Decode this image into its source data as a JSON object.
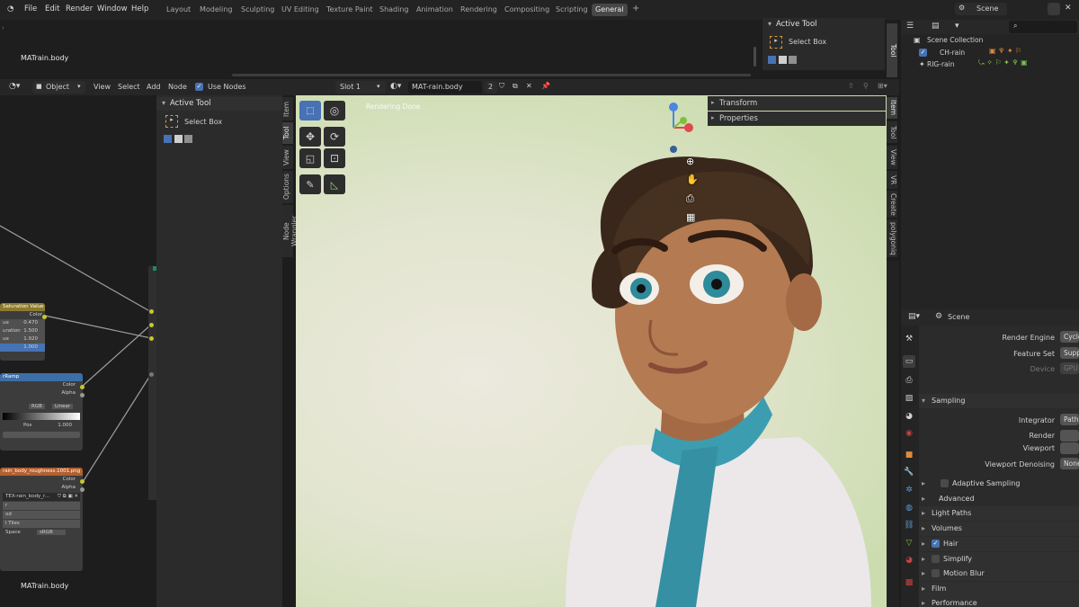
{
  "top_menu": {
    "file": "File",
    "edit": "Edit",
    "render": "Render",
    "window": "Window",
    "help": "Help"
  },
  "workspace_tabs": [
    "Layout",
    "Modeling",
    "Sculpting",
    "UV Editing",
    "Texture Paint",
    "Shading",
    "Animation",
    "Rendering",
    "Compositing",
    "Scripting",
    "General"
  ],
  "scene_name": "Scene",
  "top_editor": {
    "material_label": "MATrain.body"
  },
  "top_active_tool": {
    "title": "Active Tool",
    "tool": "Select Box",
    "tab": "Tool"
  },
  "node_header": {
    "mode": "Object",
    "view": "View",
    "select": "Select",
    "add": "Add",
    "node": "Node",
    "use_nodes": "Use Nodes",
    "slot": "Slot 1",
    "material": "MAT-rain.body",
    "users": "2"
  },
  "node_sidebar": {
    "title": "Active Tool",
    "tool": "Select Box",
    "tabs": [
      "Item",
      "Tool",
      "View",
      "Options",
      "Node Wrangler"
    ]
  },
  "nodes": {
    "hsv": {
      "title": "Saturation Value",
      "out": "Color",
      "rows": [
        {
          "label": "ue",
          "value": "0.470"
        },
        {
          "label": "uration",
          "value": "1.500"
        },
        {
          "label": "ue",
          "value": "1.920"
        },
        {
          "label": "",
          "value": "1.000"
        }
      ]
    },
    "ramp": {
      "title": "rRamp",
      "out1": "Color",
      "out2": "Alpha",
      "mode": "RGB",
      "interp": "Linear",
      "pos_label": "Pos",
      "pos_value": "1.000"
    },
    "tex": {
      "title": "rain_body_roughness.1001.png",
      "out1": "Color",
      "out2": "Alpha",
      "image": "TEX-rain_body_r...",
      "r1": "r",
      "r2": "od",
      "r3": "l Tiles",
      "space_label": "Space",
      "space_value": "sRGB"
    },
    "bottom_label": "MATrain.body"
  },
  "viewport": {
    "status": "Rendering Done",
    "panel_transform": "Transform",
    "panel_properties": "Properties",
    "tabs": [
      "Item",
      "Tool",
      "View",
      "VR",
      "Create",
      "polygoniq"
    ]
  },
  "outliner": {
    "root": "Scene Collection",
    "items": [
      "CH-rain",
      "RIG-rain"
    ]
  },
  "properties": {
    "scene": "Scene",
    "render_engine_label": "Render Engine",
    "render_engine_value": "Cycles",
    "feature_set_label": "Feature Set",
    "feature_set_value": "Supported",
    "device_label": "Device",
    "device_value": "GPU",
    "sampling": "Sampling",
    "integrator_label": "Integrator",
    "integrator_value": "Path",
    "render_label": "Render",
    "viewport_label": "Viewport",
    "denoise_label": "Viewport Denoising",
    "denoise_value": "None",
    "adaptive": "Adaptive Sampling",
    "advanced": "Advanced",
    "light_paths": "Light Paths",
    "volumes": "Volumes",
    "hair": "Hair",
    "simplify": "Simplify",
    "motion_blur": "Motion Blur",
    "film": "Film",
    "performance": "Performance"
  },
  "colors": {
    "accent": "#4772b3",
    "socket": "#c7c729",
    "hsv_header": "#8c7a2e",
    "ramp_header": "#3c6ea8",
    "tex_header": "#b35f2e"
  }
}
